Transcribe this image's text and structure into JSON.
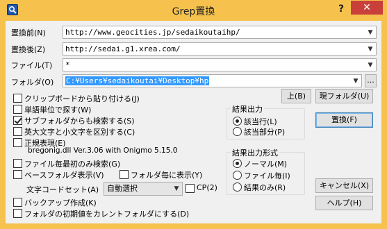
{
  "window": {
    "title": "Grep置換",
    "help_glyph": "?",
    "close_glyph": "✕"
  },
  "fields": {
    "before_label": "置換前(N)",
    "before_value": "http://www.geocities.jp/sedaikoutaihp/",
    "after_label": "置換後(Z)",
    "after_value": "http://sedai.g1.xrea.com/",
    "file_label": "ファイル(T)",
    "file_value": "*",
    "folder_label": "フォルダ(O)",
    "folder_value": "C:¥Users¥sedaikoutai¥Desktop¥hp",
    "browse_label": "..."
  },
  "buttons": {
    "up": "上(B)",
    "current_folder": "現フォルダ(U)",
    "replace": "置換(F)",
    "cancel": "キャンセル(X)",
    "help": "ヘルプ(H)"
  },
  "options": {
    "clipboard": "クリップボードから貼り付ける(J)",
    "word": "単語単位で探す(W)",
    "subfolder": "サブフォルダからも検索する(S)",
    "case": "英大文字と小文字を区別する(C)",
    "regex": "正規表現(E)",
    "regex_info": "bregonig.dll Ver.3.06 with Onigmo 5.15.0",
    "first_only": "ファイル毎最初のみ検索(G)",
    "base_folder": "ベースフォルダ表示(V)",
    "per_folder": "フォルダ毎に表示(Y)",
    "charset_label": "文字コードセット(A)",
    "charset_value": "自動選択",
    "cp": "CP(2)",
    "backup": "バックアップ作成(K)",
    "default_folder": "フォルダの初期値をカレントフォルダにする(D)"
  },
  "result_output": {
    "title": "結果出力",
    "line": "該当行(L)",
    "part": "該当部分(P)"
  },
  "result_format": {
    "title": "結果出力形式",
    "normal": "ノーマル(M)",
    "per_file": "ファイル毎(I)",
    "result_only": "結果のみ(R)"
  }
}
